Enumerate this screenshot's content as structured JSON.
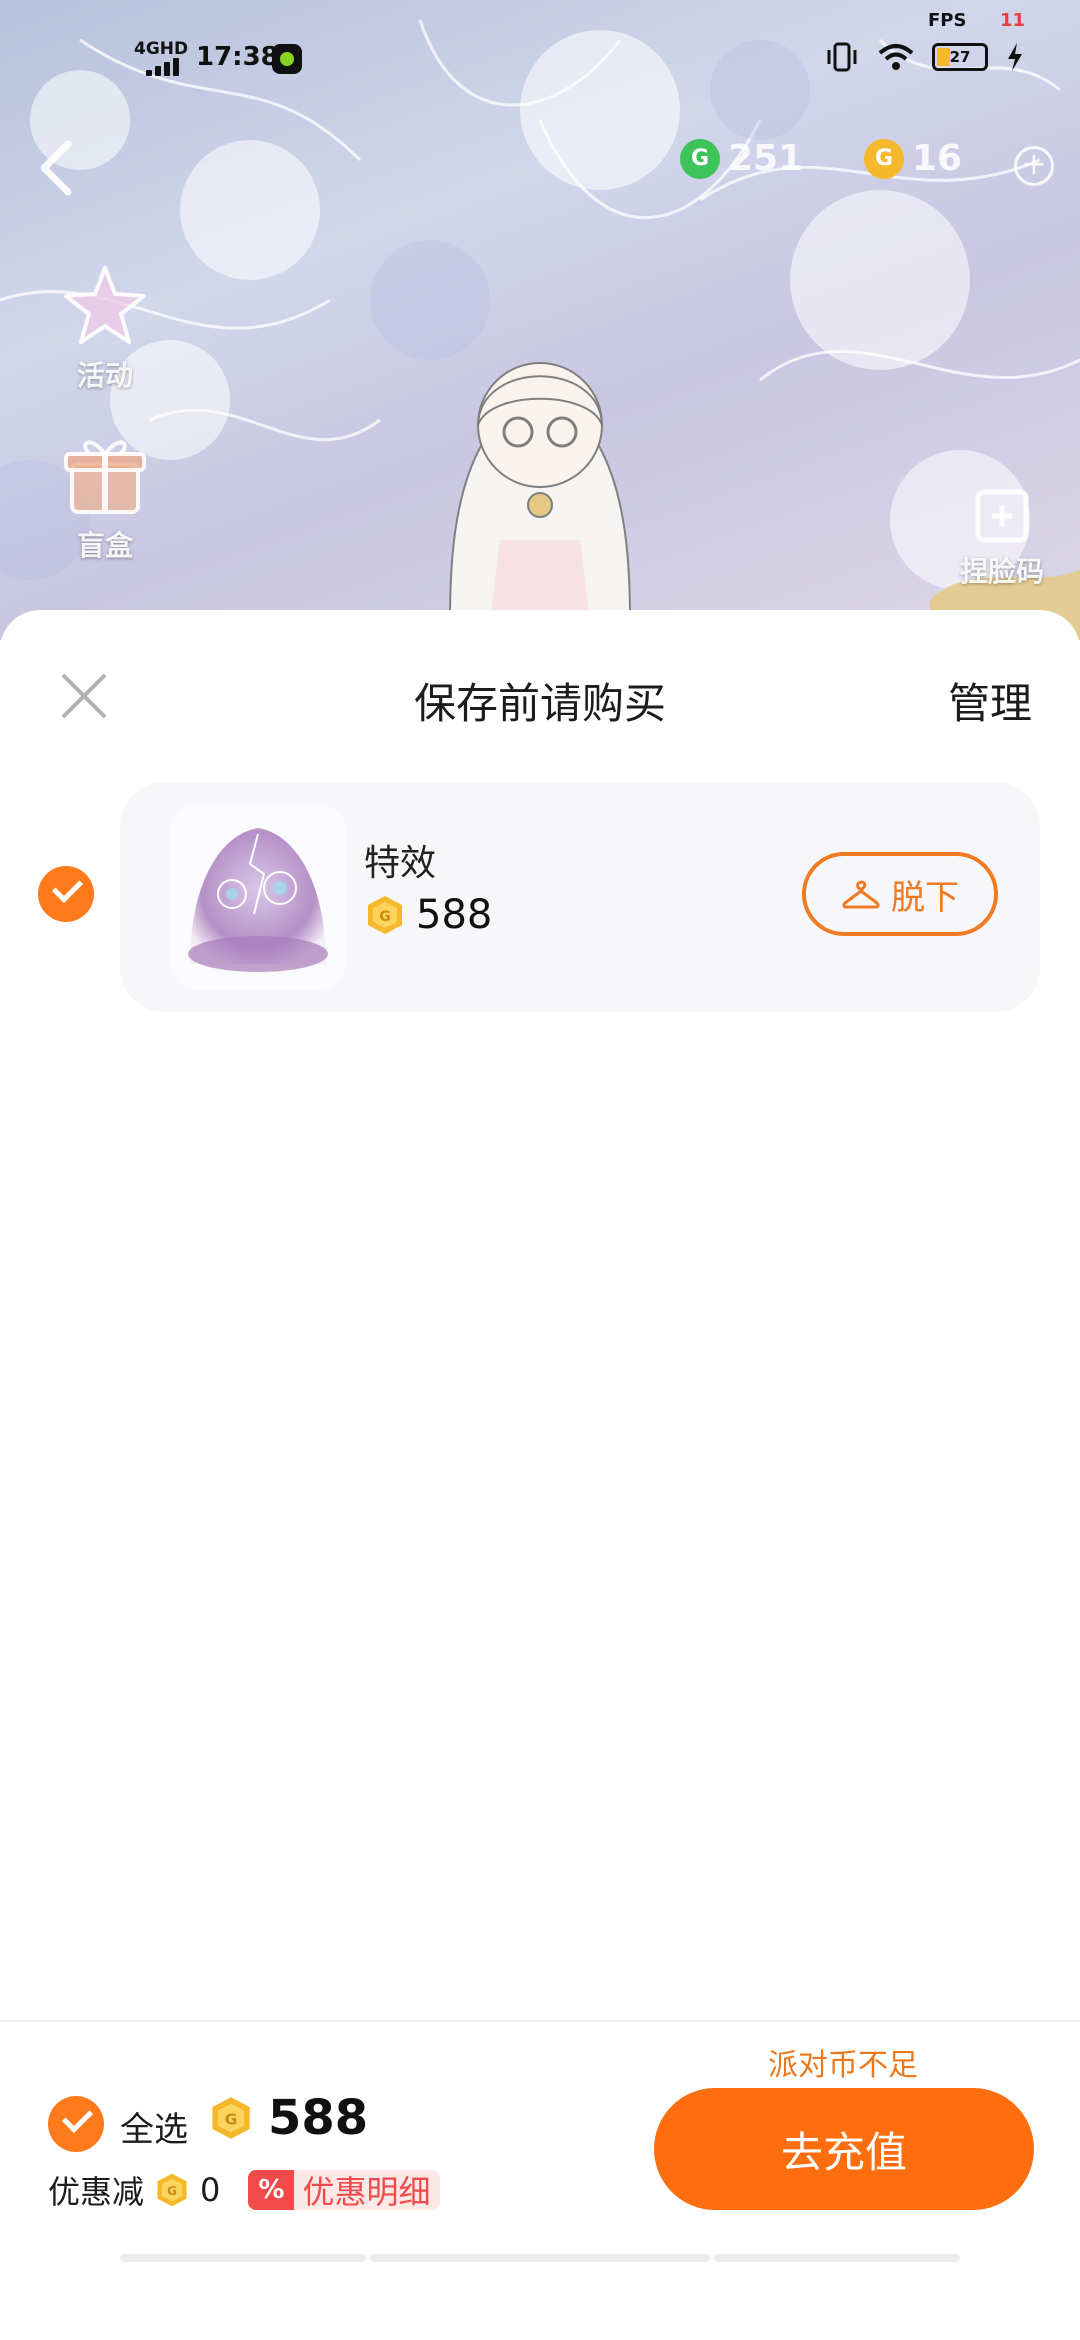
{
  "status_bar": {
    "network": "4GHD",
    "time": "17:38",
    "fps_label": "FPS",
    "fps_value": "11",
    "battery": "27"
  },
  "scene": {
    "green_currency": "251",
    "gold_currency": "16",
    "side_left": [
      {
        "label": "活动"
      },
      {
        "label": "盲盒"
      }
    ],
    "side_right": {
      "label": "捏脸码"
    }
  },
  "sheet": {
    "title": "保存前请购买",
    "manage": "管理",
    "items": [
      {
        "name": "特效",
        "price": "588",
        "action": "脱下",
        "selected": true
      }
    ]
  },
  "footer": {
    "select_all": "全选",
    "total": "588",
    "discount_label": "优惠减",
    "discount_value": "0",
    "discount_badge": "%",
    "discount_detail": "优惠明细",
    "insufficient_notice": "派对币不足",
    "recharge_button": "去充值"
  },
  "colors": {
    "accent": "#fe6e0f",
    "outline": "#f07a22",
    "coin_gold": "#f5b82a",
    "coin_green": "#3cc45a",
    "discount_red": "#f04a4a"
  }
}
